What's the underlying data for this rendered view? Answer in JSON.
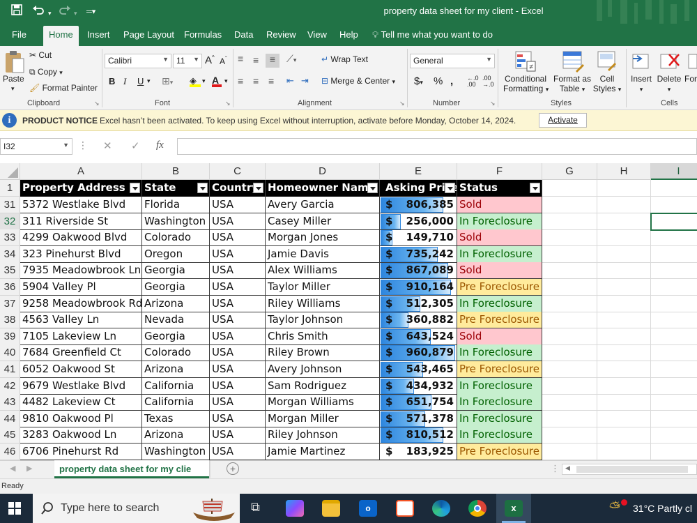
{
  "window": {
    "title": "property data sheet for my client  -  Excel"
  },
  "ribbon_tabs": [
    "File",
    "Home",
    "Insert",
    "Page Layout",
    "Formulas",
    "Data",
    "Review",
    "View",
    "Help"
  ],
  "tell_me": "Tell me what you want to do",
  "ribbon": {
    "clipboard": {
      "paste": "Paste",
      "cut": "Cut",
      "copy": "Copy",
      "format_painter": "Format Painter",
      "label": "Clipboard"
    },
    "font": {
      "name": "Calibri",
      "size": "11",
      "label": "Font"
    },
    "alignment": {
      "wrap": "Wrap Text",
      "merge": "Merge & Center",
      "label": "Alignment"
    },
    "number": {
      "format": "General",
      "label": "Number"
    },
    "styles": {
      "conditional_1": "Conditional",
      "conditional_2": "Formatting",
      "format_table_1": "Format as",
      "format_table_2": "Table",
      "cell_styles_1": "Cell",
      "cell_styles_2": "Styles",
      "label": "Styles"
    },
    "cells": {
      "insert": "Insert",
      "delete": "Delete",
      "format": "For",
      "label": "Cells"
    }
  },
  "notice": {
    "heading": "PRODUCT NOTICE",
    "message": "Excel hasn’t been activated. To keep using Excel without interruption, activate before Monday, October 14, 2024.",
    "button": "Activate"
  },
  "formula_bar": {
    "name_box": "I32",
    "fx": "fx",
    "formula": ""
  },
  "columns": [
    "A",
    "B",
    "C",
    "D",
    "E",
    "F",
    "G",
    "H",
    "I"
  ],
  "header_row": {
    "row_number": "1",
    "cells": [
      "Property Address",
      "State",
      "Country",
      "Homeowner Name",
      "Asking Price",
      "Status"
    ]
  },
  "rows": [
    {
      "n": "31",
      "address": "5372 Westlake Blvd",
      "state": "Florida",
      "country": "USA",
      "owner": "Avery Garcia",
      "dollar": "$",
      "price": "806,385",
      "price_value": 806385,
      "status": "Sold"
    },
    {
      "n": "32",
      "address": "311 Riverside St",
      "state": "Washington",
      "country": "USA",
      "owner": "Casey Miller",
      "dollar": "$",
      "price": "256,000",
      "price_value": 256000,
      "status": "In Foreclosure"
    },
    {
      "n": "33",
      "address": "4299 Oakwood Blvd",
      "state": "Colorado",
      "country": "USA",
      "owner": "Morgan Jones",
      "dollar": "$",
      "price": "149,710",
      "price_value": 149710,
      "status": "Sold"
    },
    {
      "n": "34",
      "address": "323 Pinehurst Blvd",
      "state": "Oregon",
      "country": "USA",
      "owner": "Jamie Davis",
      "dollar": "$",
      "price": "735,242",
      "price_value": 735242,
      "status": "In Foreclosure"
    },
    {
      "n": "35",
      "address": "7935 Meadowbrook Ln",
      "state": "Georgia",
      "country": "USA",
      "owner": "Alex Williams",
      "dollar": "$",
      "price": "867,089",
      "price_value": 867089,
      "status": "Sold"
    },
    {
      "n": "36",
      "address": "5904 Valley Pl",
      "state": "Georgia",
      "country": "USA",
      "owner": "Taylor Miller",
      "dollar": "$",
      "price": "910,164",
      "price_value": 910164,
      "status": "Pre Foreclosure"
    },
    {
      "n": "37",
      "address": "9258 Meadowbrook Rd",
      "state": "Arizona",
      "country": "USA",
      "owner": "Riley Williams",
      "dollar": "$",
      "price": "512,305",
      "price_value": 512305,
      "status": "In Foreclosure"
    },
    {
      "n": "38",
      "address": "4563 Valley Ln",
      "state": "Nevada",
      "country": "USA",
      "owner": "Taylor Johnson",
      "dollar": "$",
      "price": "360,882",
      "price_value": 360882,
      "status": "Pre Foreclosure"
    },
    {
      "n": "39",
      "address": "7105 Lakeview Ln",
      "state": "Georgia",
      "country": "USA",
      "owner": "Chris Smith",
      "dollar": "$",
      "price": "643,524",
      "price_value": 643524,
      "status": "Sold"
    },
    {
      "n": "40",
      "address": "7684 Greenfield Ct",
      "state": "Colorado",
      "country": "USA",
      "owner": "Riley Brown",
      "dollar": "$",
      "price": "960,879",
      "price_value": 960879,
      "status": "In Foreclosure"
    },
    {
      "n": "41",
      "address": "6052 Oakwood St",
      "state": "Arizona",
      "country": "USA",
      "owner": "Avery Johnson",
      "dollar": "$",
      "price": "543,465",
      "price_value": 543465,
      "status": "Pre Foreclosure"
    },
    {
      "n": "42",
      "address": "9679 Westlake Blvd",
      "state": "California",
      "country": "USA",
      "owner": "Sam Rodriguez",
      "dollar": "$",
      "price": "434,932",
      "price_value": 434932,
      "status": "In Foreclosure"
    },
    {
      "n": "43",
      "address": "4482 Lakeview Ct",
      "state": "California",
      "country": "USA",
      "owner": "Morgan Williams",
      "dollar": "$",
      "price": "651,754",
      "price_value": 651754,
      "status": "In Foreclosure"
    },
    {
      "n": "44",
      "address": "9810 Oakwood Pl",
      "state": "Texas",
      "country": "USA",
      "owner": "Morgan Miller",
      "dollar": "$",
      "price": "571,378",
      "price_value": 571378,
      "status": "In Foreclosure"
    },
    {
      "n": "45",
      "address": "3283 Oakwood Ln",
      "state": "Arizona",
      "country": "USA",
      "owner": "Riley Johnson",
      "dollar": "$",
      "price": "810,512",
      "price_value": 810512,
      "status": "In Foreclosure"
    },
    {
      "n": "46",
      "address": "6706 Pinehurst Rd",
      "state": "Washington",
      "country": "USA",
      "owner": "Jamie Martinez",
      "dollar": "$",
      "price": "183,925",
      "price_value": 183925,
      "status": "Pre Foreclosure"
    }
  ],
  "data_bar_max": 960879,
  "status_colors": {
    "Sold": "#ffc7ce",
    "In Foreclosure": "#c6efce",
    "Pre Foreclosure": "#ffeb9c"
  },
  "sheet_tab": "property data sheet for my clie",
  "status_bar": "Ready",
  "taskbar": {
    "search_placeholder": "Type here to search",
    "weather": "31°C  Partly cl"
  },
  "accent": "#217346"
}
